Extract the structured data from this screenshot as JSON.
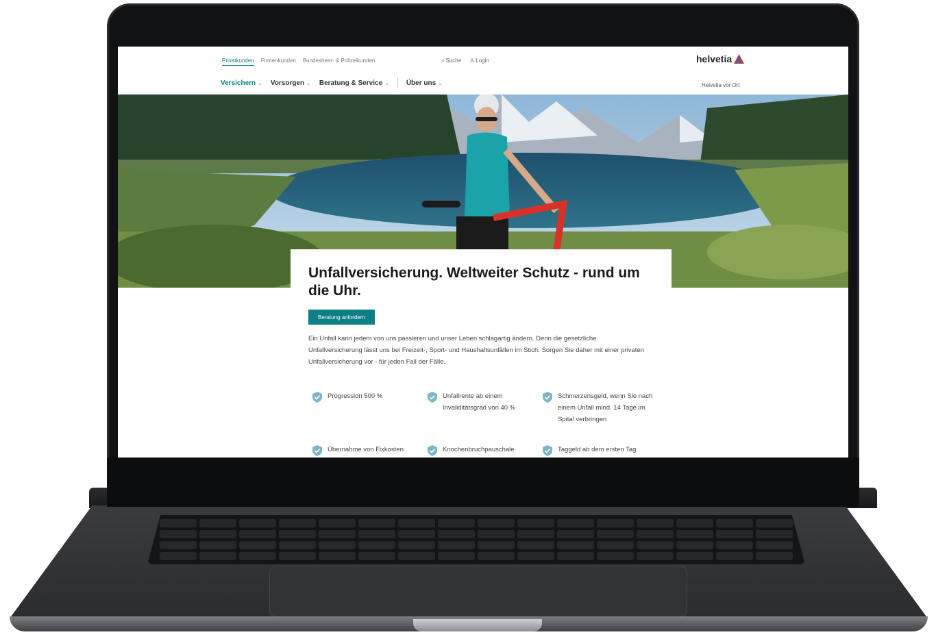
{
  "header": {
    "segments": [
      {
        "label": "Privatkunden",
        "active": true
      },
      {
        "label": "Firmenkunden",
        "active": false
      },
      {
        "label": "Bundesheer- & Polizeikunden",
        "active": false
      }
    ],
    "search_label": "Suche",
    "login_label": "Login",
    "logo_text": "helvetia",
    "nav": [
      {
        "label": "Versichern",
        "active": true
      },
      {
        "label": "Vorsorgen",
        "active": false
      },
      {
        "label": "Beratung & Service",
        "active": false
      },
      {
        "label": "Über uns",
        "active": false
      }
    ],
    "location_link": "Helvetia vor Ort"
  },
  "content": {
    "headline": "Unfallversicherung. Weltweiter Schutz - rund um die Uhr.",
    "cta_label": "Beratung anfordern",
    "intro": "Ein Unfall kann jedem von uns passieren und unser Leben schlagartig ändern. Denn die gesetzliche Unfallversicherung lässt uns bei Freizeit-, Sport- und Haushaltsunfällen im Stich. Sorgen Sie daher mit einer privaten Unfallversicherung vor - für jeden Fall der Fälle.",
    "features": [
      "Progression 500 %",
      "Unfallrente ab einem Invaliditätsgrad von 40 %",
      "Schmerzensgeld, wenn Sie nach einem Unfall mind. 14 Tage im Spital verbringen",
      "Übernahme von Fixkosten",
      "Knochenbruchpauschale",
      "Taggeld ab dem ersten Tag"
    ]
  },
  "colors": {
    "accent": "#0e7f86",
    "logo_red": "#d6322b",
    "laptop": "#111214"
  },
  "icons": {
    "search": "search-icon",
    "login": "user-icon",
    "feature": "shield-check-icon",
    "dropdown": "chevron-down-icon"
  }
}
